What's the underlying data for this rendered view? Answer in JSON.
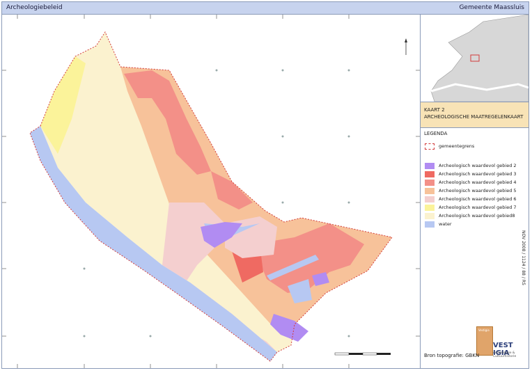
{
  "header": {
    "left_title": "Archeologiebeleid",
    "right_title": "Gemeente Maassluis"
  },
  "kaart": {
    "line1": "KAART 2",
    "line2": "ARCHEOLOGISCHE MAATREGELENKAART"
  },
  "legend": {
    "heading": "LEGENDA",
    "boundary_label": "gemeentegrens",
    "items": [
      {
        "label": "Archeologisch waardevol gebied 2",
        "color": "#b18cf2"
      },
      {
        "label": "Archeologisch waardevol gebied 3",
        "color": "#ef6a62"
      },
      {
        "label": "Archeologisch waardevol gebied 4",
        "color": "#f39088"
      },
      {
        "label": "Archeologisch waardevol gebied 5",
        "color": "#f7c29a"
      },
      {
        "label": "Archeologisch waardevol gebied 6",
        "color": "#f4cfcf"
      },
      {
        "label": "Archeologisch waardevol gebied 7",
        "color": "#fbf39a"
      },
      {
        "label": "Archeologisch waardevol gebied8",
        "color": "#fbf2cf"
      },
      {
        "label": "water",
        "color": "#b7c8f2"
      }
    ]
  },
  "source": "Bron topografie: GBKN",
  "stamp": "NOV 2008 / 1124 / 88 / RS",
  "logo": {
    "brand": "VEST IGIA",
    "tagline": "Archeologie & Cultuurhistorie",
    "book_text": "Vestigia"
  },
  "colors": {
    "frame": "#8a9ab8",
    "header": "#c7d3ee",
    "title_box": "#f8e3b6",
    "boundary": "#d23b3b"
  }
}
